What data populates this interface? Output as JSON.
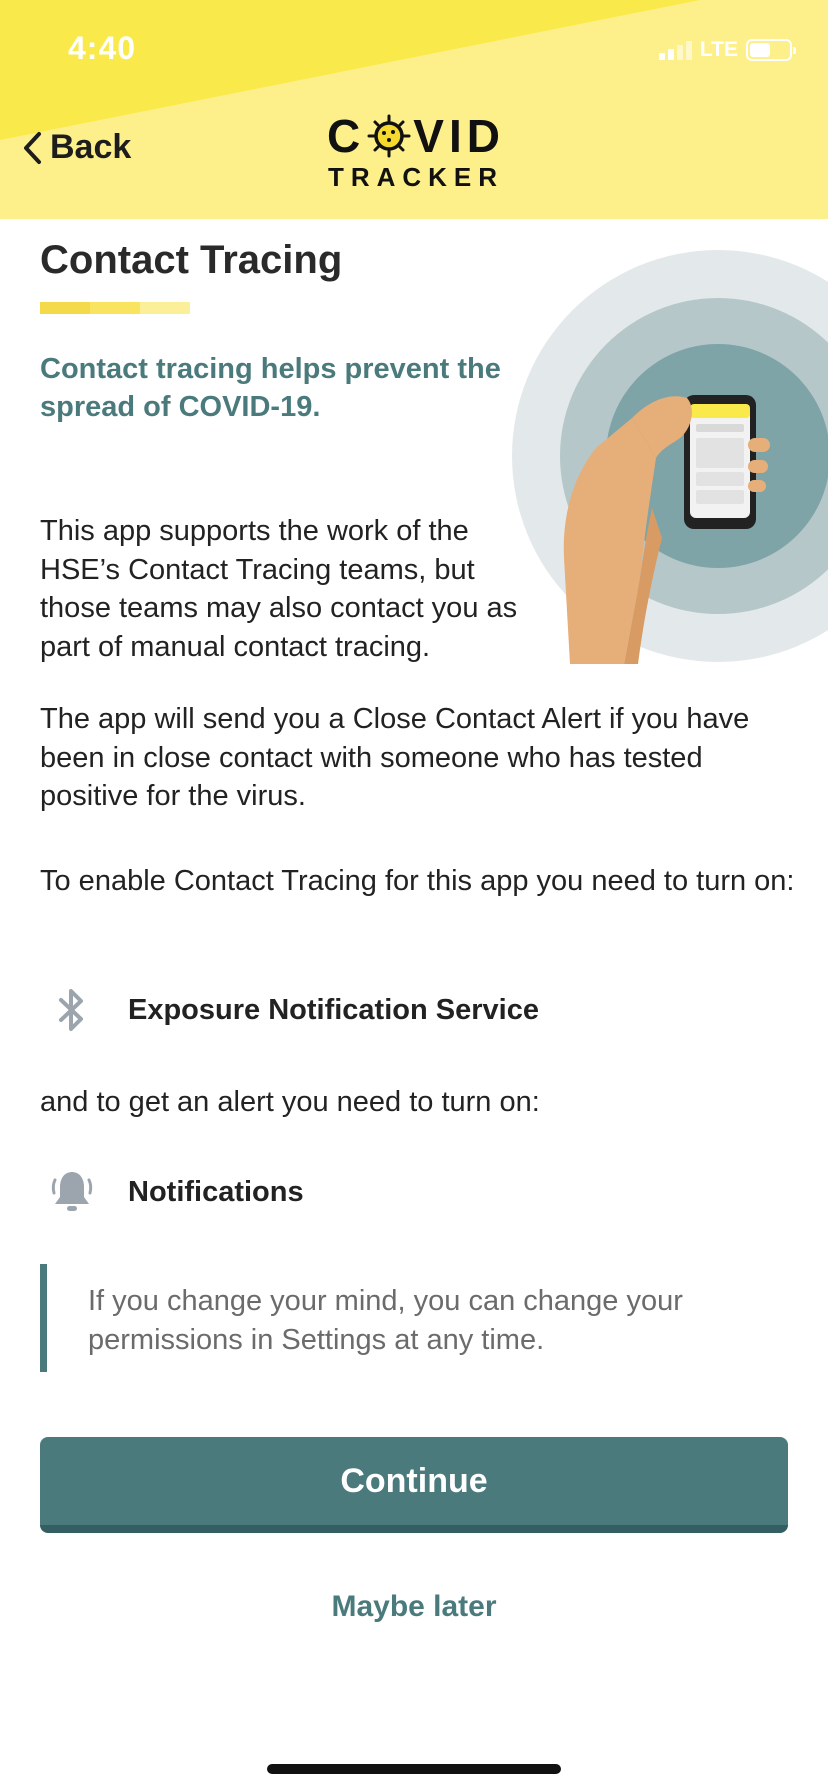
{
  "status_bar": {
    "time": "4:40",
    "network": "LTE"
  },
  "header": {
    "back_label": "Back",
    "logo_top_left": "C",
    "logo_top_right": "VID",
    "logo_bottom": "TRACKER"
  },
  "content": {
    "title": "Contact Tracing",
    "subtitle": "Contact tracing helps prevent the spread of COVID-19.",
    "paragraph_1": "This app supports the work of the HSE’s Contact Tracing teams, but those teams may also contact you as part of manual contact tracing.",
    "paragraph_2": "The app will send you a Close Contact Alert if you have been in close contact with someone who has tested positive for the virus.",
    "paragraph_3": "To enable Contact Tracing for this app you need to turn on:",
    "permission_1": {
      "icon": "bluetooth-icon",
      "label": "Exposure Notification Service"
    },
    "paragraph_4": "and to get an alert you need to turn on:",
    "permission_2": {
      "icon": "bell-icon",
      "label": "Notifications"
    },
    "note": "If you change your mind, you can change your permissions in Settings at any time."
  },
  "actions": {
    "continue_label": "Continue",
    "later_label": "Maybe later"
  },
  "colors": {
    "header_bg": "#fdf08a",
    "header_band": "#fae94a",
    "accent_teal": "#4b7a7d",
    "accent_teal_dark": "#335e62"
  }
}
